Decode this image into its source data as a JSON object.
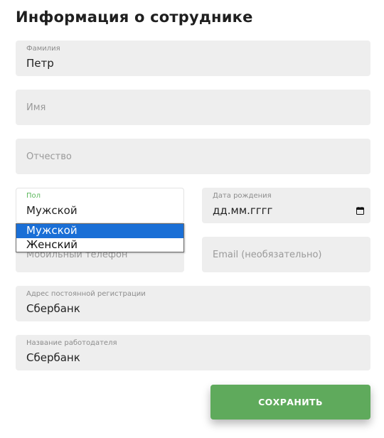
{
  "form": {
    "title": "Информация о сотруднике",
    "last_name": {
      "label": "Фамилия",
      "value": "Петр"
    },
    "first_name": {
      "placeholder": "Имя"
    },
    "middle_name": {
      "placeholder": "Отчество"
    },
    "gender": {
      "label": "Пол",
      "value": "Мужской",
      "options": [
        "Мужской",
        "Женский"
      ],
      "highlighted_option": "Мужской"
    },
    "birth_date": {
      "label": "Дата рождения",
      "value": "дд.мм.гггг",
      "icon": "calendar-icon"
    },
    "phone": {
      "placeholder": "Мобильный телефон"
    },
    "email": {
      "placeholder": "Email (необязательно)"
    },
    "address": {
      "label": "Адрес постоянной регистрации",
      "value": "Сбербанк"
    },
    "employer": {
      "label": "Название работодателя",
      "value": "Сбербанк"
    },
    "save_label": "СОХРАНИТЬ"
  },
  "colors": {
    "field_bg": "#eeeeee",
    "accent_green": "#5faa5c",
    "focus_label_green": "#5cb85c",
    "dropdown_highlight": "#1a6fd6"
  }
}
